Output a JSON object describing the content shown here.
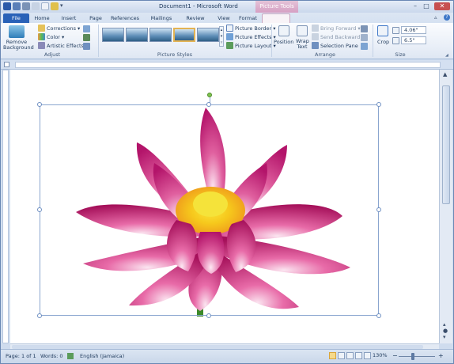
{
  "window": {
    "title": "Document1 - Microsoft Word",
    "context_group": "Picture Tools"
  },
  "tabs": [
    "File",
    "Home",
    "Insert",
    "Page Layout",
    "References",
    "Mailings",
    "Review",
    "View",
    "Format"
  ],
  "ribbon": {
    "remove_background": "Remove Background",
    "corrections": "Corrections",
    "color": "Color",
    "artistic_effects": "Artistic Effects",
    "adjust_label": "Adjust",
    "picture_styles_label": "Picture Styles",
    "picture_border": "Picture Border",
    "picture_effects": "Picture Effects",
    "picture_layout": "Picture Layout",
    "position": "Position",
    "wrap_text": "Wrap Text",
    "bring_forward": "Bring Forward",
    "send_backward": "Send Backward",
    "selection_pane": "Selection Pane",
    "arrange_label": "Arrange",
    "crop": "Crop",
    "height": "4.06\"",
    "width": "6.5\"",
    "size_label": "Size"
  },
  "status": {
    "page": "Page: 1 of 1",
    "words": "Words: 0",
    "language": "English (Jamaica)",
    "zoom": "130%"
  },
  "colors": {
    "file_tab": "#2a62b8",
    "context_tab": "#d69fc3",
    "petal_dark": "#b0125f",
    "petal_light": "#f6c7de",
    "stamen": "#f3c51c"
  }
}
